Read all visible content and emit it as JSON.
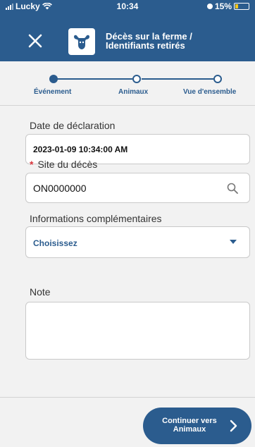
{
  "status_bar": {
    "carrier": "Lucky",
    "time": "10:34",
    "battery": "15%"
  },
  "header": {
    "title": "Décès sur la ferme / Identifiants retirés",
    "icons": {
      "close": "close-icon",
      "logo": "cow-icon"
    },
    "colors": {
      "background": "#2b5c8e",
      "text": "#ffffff"
    }
  },
  "stepper": {
    "steps": [
      {
        "label": "Événement",
        "state": "active"
      },
      {
        "label": "Animaux",
        "state": "inactive"
      },
      {
        "label": "Vue d'ensemble",
        "state": "inactive"
      }
    ]
  },
  "form": {
    "declaration_date": {
      "label": "Date de déclaration",
      "value": "2023-01-09 10:34:00 AM"
    },
    "death_site": {
      "required_mark": "*",
      "label": "Site du décès",
      "value": "ON0000000",
      "icon": "search-icon"
    },
    "additional_info": {
      "label": "Informations complémentaires",
      "value": "Choisissez",
      "icon": "caret-down-icon"
    },
    "note": {
      "label": "Note",
      "value": ""
    }
  },
  "footer": {
    "continue_label": "Continuer vers\nAnimaux",
    "icon": "chevron-right-icon"
  },
  "colors": {
    "accent": "#2b5c8e",
    "required": "#d9363e",
    "background": "#f2f2f2"
  }
}
